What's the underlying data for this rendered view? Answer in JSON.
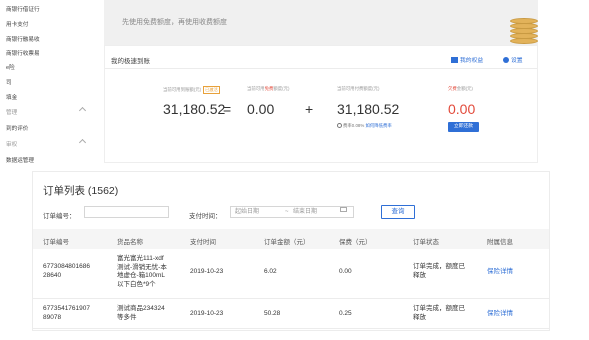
{
  "sidebar": {
    "items": [
      {
        "label": "商银行借证行",
        "type": "item"
      },
      {
        "label": "用卡支付",
        "type": "item"
      },
      {
        "label": "商银行融易收",
        "type": "item"
      },
      {
        "label": "商银行收票易",
        "type": "item"
      },
      {
        "label": "e险",
        "type": "item"
      },
      {
        "label": "司",
        "type": "item"
      },
      {
        "label": "填金",
        "type": "item"
      },
      {
        "label": "管理",
        "type": "category"
      },
      {
        "label": "到的评价",
        "type": "item"
      },
      {
        "label": "审权",
        "type": "category"
      },
      {
        "label": "数据运管理",
        "type": "item"
      }
    ]
  },
  "banner": {
    "text": "先使用免费额度，再使用收费额度"
  },
  "fast": {
    "title": "我的极速到账",
    "my_rights": "我的权益",
    "settings": "设置",
    "label_available": "当前可用到账额(元)",
    "tag_enabled": "已激活",
    "label_free_prefix": "当前可用",
    "label_free_red": "免费",
    "label_free_suffix": "额度(元)",
    "label_paid": "当前可用付费额度(元)",
    "label_unpaid_red": "欠费",
    "label_unpaid_suffix": "金额(元)",
    "available_value": "31,180.52",
    "equals": "=",
    "free_value": "0.00",
    "plus": "+",
    "paid_value": "31,180.52",
    "unpaid_value": "0.00",
    "hint_prefix": "费率0.08%",
    "hint_link": "如何降低费率",
    "pay_button": "立即还款"
  },
  "orders": {
    "title": "订单列表 (1562)",
    "filter_order_label": "订单编号：",
    "filter_time_label": "支付时间：",
    "start_placeholder": "起始日期",
    "range_sep": "~",
    "end_placeholder": "结束日期",
    "query_button": "查询",
    "columns": [
      "订单编号",
      "货品名称",
      "支付时间",
      "订单金额（元）",
      "保费（元）",
      "订单状态",
      "附属信息"
    ],
    "rows": [
      {
        "order_no": [
          "6773084801686",
          "28640"
        ],
        "product": [
          "富光富光111-xdf",
          "测试-滑销无忧-本",
          "地虚仓-箱100mL",
          "以下白色*9个"
        ],
        "pay_time": "2019-10-23",
        "amount": "6.02",
        "premium": "0.00",
        "status": [
          "订单完成，额度已",
          "释放"
        ],
        "info": "保险详情"
      },
      {
        "order_no": [
          "6773541761907",
          "89078"
        ],
        "product": [
          "测试商品234324",
          "等多件"
        ],
        "pay_time": "2019-10-23",
        "amount": "50.28",
        "premium": "0.25",
        "status": [
          "订单完成，额度已",
          "释放"
        ],
        "info": "保险详情"
      }
    ]
  },
  "colors": {
    "accent": "#2f6fd6",
    "alert": "#e24a3b",
    "tag": "#e8a13a"
  }
}
